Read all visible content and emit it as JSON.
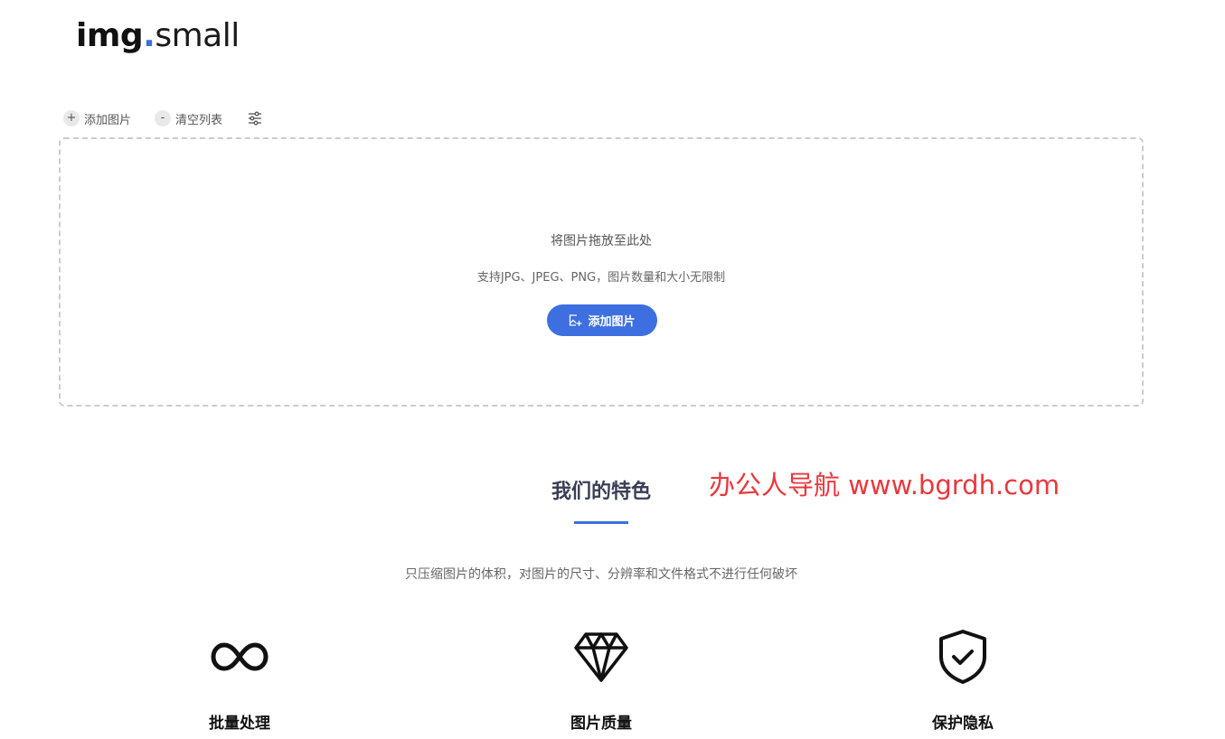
{
  "logo": {
    "part1": "img",
    "dot": ".",
    "part2": "small"
  },
  "toolbar": {
    "add_icon": "+",
    "add_label": "添加图片",
    "clear_icon": "-",
    "clear_label": "清空列表",
    "settings_icon": "sliders-icon"
  },
  "dropzone": {
    "title": "将图片拖放至此处",
    "subtitle": "支持JPG、JPEG、PNG，图片数量和大小无限制",
    "button_label": "添加图片"
  },
  "features": {
    "title": "我们的特色",
    "description": "只压缩图片的体积，对图片的尺寸、分辨率和文件格式不进行任何破坏",
    "items": [
      {
        "label": "批量处理",
        "icon": "infinity-icon"
      },
      {
        "label": "图片质量",
        "icon": "diamond-icon"
      },
      {
        "label": "保护隐私",
        "icon": "shield-check-icon"
      }
    ]
  },
  "watermark": "办公人导航 www.bgrdh.com",
  "colors": {
    "accent": "#3d6fe0",
    "watermark": "#e8383d"
  }
}
